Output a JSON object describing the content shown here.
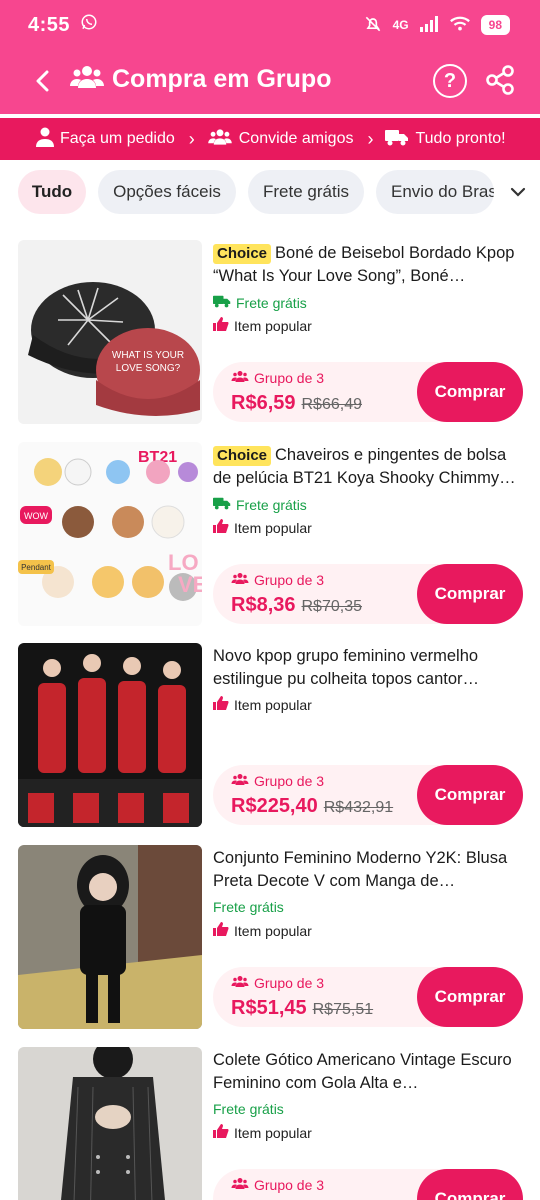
{
  "status": {
    "time": "4:55",
    "network": "4G",
    "battery": "98"
  },
  "header": {
    "title": "Compra em Grupo",
    "help_icon": "help-icon",
    "share_icon": "share-icon"
  },
  "steps": [
    "Faça um pedido",
    "Convide amigos",
    "Tudo pronto!"
  ],
  "chips": [
    "Tudo",
    "Opções fáceis",
    "Frete grátis",
    "Envio do Bras"
  ],
  "colors": {
    "brand_pink": "#f7468f",
    "accent_red": "#e8195e",
    "free_green": "#18a048",
    "choice_yellow": "#ffe45c"
  },
  "products": [
    {
      "choice": "Choice",
      "name": "Boné de Beisebol Bordado Kpop “What Is Your Love Song”, Boné…",
      "free_shipping": "Frete grátis",
      "popular": "Item popular",
      "group": "Grupo de 3",
      "price": "R$6,59",
      "old_price": "R$66,49",
      "buy": "Comprar"
    },
    {
      "choice": "Choice",
      "name": "Chaveiros e pingentes de bolsa de pelúcia BT21 Koya Shooky Chimmy…",
      "free_shipping": "Frete grátis",
      "popular": "Item popular",
      "group": "Grupo de 3",
      "price": "R$8,36",
      "old_price": "R$70,35",
      "buy": "Comprar"
    },
    {
      "choice": "",
      "name": "Novo kpop grupo feminino vermelho estilingue pu colheita topos cantor…",
      "free_shipping": "",
      "popular": "Item popular",
      "group": "Grupo de 3",
      "price": "R$225,40",
      "old_price": "R$432,91",
      "buy": "Comprar"
    },
    {
      "choice": "",
      "name": "Conjunto Feminino Moderno Y2K: Blusa Preta Decote V com Manga de…",
      "free_shipping": "Frete grátis",
      "popular": "Item popular",
      "group": "Grupo de 3",
      "price": "R$51,45",
      "old_price": "R$75,51",
      "buy": "Comprar"
    },
    {
      "choice": "",
      "name": "Colete Gótico Americano Vintage Escuro Feminino com Gola Alta e…",
      "free_shipping": "Frete grátis",
      "popular": "Item popular",
      "group": "Grupo de 3",
      "price": "",
      "old_price": "",
      "buy": "Comprar"
    }
  ]
}
